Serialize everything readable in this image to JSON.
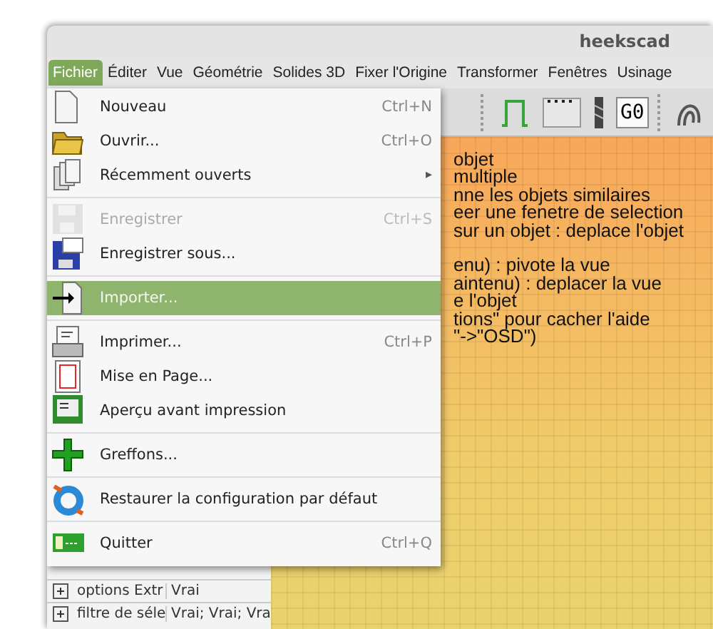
{
  "window": {
    "title": "heekscad"
  },
  "menubar": [
    {
      "label": "Fichier",
      "selected": true
    },
    {
      "label": "Éditer",
      "selected": false
    },
    {
      "label": "Vue",
      "selected": false
    },
    {
      "label": "Géométrie",
      "selected": false
    },
    {
      "label": "Solides 3D",
      "selected": false
    },
    {
      "label": "Fixer l'Origine",
      "selected": false
    },
    {
      "label": "Transformer",
      "selected": false
    },
    {
      "label": "Fenêtres",
      "selected": false
    },
    {
      "label": "Usinage",
      "selected": false
    }
  ],
  "toolbar": {
    "g0_label": "G0"
  },
  "menu": {
    "groups": [
      [
        {
          "label": "Nouveau",
          "shortcut": "Ctrl+N",
          "disabled": false,
          "selected": false
        },
        {
          "label": "Ouvrir...",
          "shortcut": "Ctrl+O",
          "disabled": false,
          "selected": false
        },
        {
          "label": "Récemment ouverts",
          "submenu_arrow": "▸",
          "disabled": false,
          "selected": false
        }
      ],
      [
        {
          "label": "Enregistrer",
          "shortcut": "Ctrl+S",
          "disabled": true,
          "selected": false
        },
        {
          "label": "Enregistrer sous...",
          "disabled": false,
          "selected": false
        }
      ],
      [
        {
          "label": "Importer...",
          "disabled": false,
          "selected": true
        }
      ],
      [
        {
          "label": "Imprimer...",
          "shortcut": "Ctrl+P",
          "disabled": false,
          "selected": false
        },
        {
          "label": "Mise en Page...",
          "disabled": false,
          "selected": false
        },
        {
          "label": "Aperçu avant impression",
          "disabled": false,
          "selected": false
        }
      ],
      [
        {
          "label": "Greffons...",
          "disabled": false,
          "selected": false
        }
      ],
      [
        {
          "label": "Restaurer la configuration par défaut",
          "disabled": false,
          "selected": false
        }
      ],
      [
        {
          "label": "Quitter",
          "shortcut": "Ctrl+Q",
          "disabled": false,
          "selected": false
        }
      ]
    ]
  },
  "canvas": {
    "help_paragraphs": [
      [
        "objet",
        "multiple",
        "nne les objets similaires",
        "eer une fenetre de selection",
        "sur un objet : deplace l'objet"
      ],
      [
        "enu) : pivote la vue",
        "aintenu) : deplacer la vue",
        "e l'objet",
        "tions\" pour cacher l'aide",
        "\"->\"OSD\")"
      ]
    ]
  },
  "properties": {
    "rows": [
      {
        "name": "options Extr",
        "value": "Vrai",
        "expanded": false
      },
      {
        "name": "filtre de séle",
        "value": "Vrai; Vrai; Vra",
        "expanded": false
      }
    ]
  }
}
